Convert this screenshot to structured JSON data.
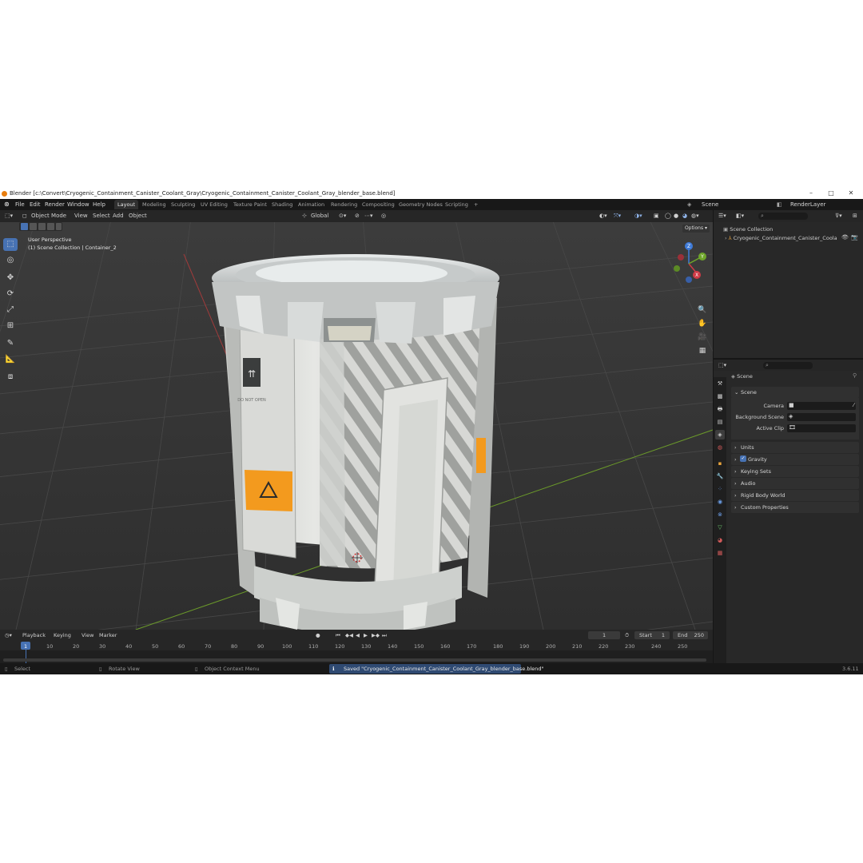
{
  "window": {
    "title": "Blender [c:\\Convert\\Cryogenic_Containment_Canister_Coolant_Gray\\Cryogenic_Containment_Canister_Coolant_Gray_blender_base.blend]",
    "minimize": "–",
    "maximize": "□",
    "close": "✕"
  },
  "menu": [
    "File",
    "Edit",
    "Render",
    "Window",
    "Help"
  ],
  "workspaces": [
    "Layout",
    "Modeling",
    "Sculpting",
    "UV Editing",
    "Texture Paint",
    "Shading",
    "Animation",
    "Rendering",
    "Compositing",
    "Geometry Nodes",
    "Scripting"
  ],
  "workspace_add": "+",
  "scene_selector": {
    "scene": "Scene",
    "view_layer": "RenderLayer"
  },
  "viewport_header": {
    "mode": "Object Mode",
    "menus": [
      "View",
      "Select",
      "Add",
      "Object"
    ],
    "orientation": "Global",
    "options": "Options"
  },
  "viewport": {
    "perspective": "User Perspective",
    "collection_info": "(1) Scene Collection | Container_2",
    "gizmo": {
      "x": "X",
      "y": "Y",
      "z": "Z"
    },
    "canister_label": "DO NOT OPEN"
  },
  "outliner": {
    "root": "Scene Collection",
    "items": [
      {
        "label": "Cryogenic_Containment_Canister_Coola"
      }
    ]
  },
  "properties": {
    "breadcrumb": "Scene",
    "panel_title": "Scene",
    "fields": [
      {
        "label": "Camera"
      },
      {
        "label": "Background Scene"
      },
      {
        "label": "Active Clip"
      }
    ],
    "sections": [
      {
        "label": "Units"
      },
      {
        "label": "Gravity",
        "checked": true
      },
      {
        "label": "Keying Sets"
      },
      {
        "label": "Audio"
      },
      {
        "label": "Rigid Body World"
      },
      {
        "label": "Custom Properties"
      }
    ]
  },
  "timeline": {
    "menus": [
      "Playback",
      "Keying",
      "View",
      "Marker"
    ],
    "current_frame": "1",
    "start_label": "Start",
    "start": "1",
    "end_label": "End",
    "end": "250",
    "ticks": [
      "1",
      "10",
      "20",
      "30",
      "40",
      "50",
      "60",
      "70",
      "80",
      "90",
      "100",
      "110",
      "120",
      "130",
      "140",
      "150",
      "160",
      "170",
      "180",
      "190",
      "200",
      "210",
      "220",
      "230",
      "240",
      "250"
    ]
  },
  "statusbar": {
    "select": "Select",
    "rotate": "Rotate View",
    "context": "Object Context Menu",
    "message": "Saved \"Cryogenic_Containment_Canister_Coolant_Gray_blender_base.blend\"",
    "version": "3.6.11"
  },
  "colors": {
    "accent": "#4772b3",
    "orange_label": "#f39a1e",
    "grid_red": "#a03b3b",
    "grid_green": "#6b9a2a"
  }
}
